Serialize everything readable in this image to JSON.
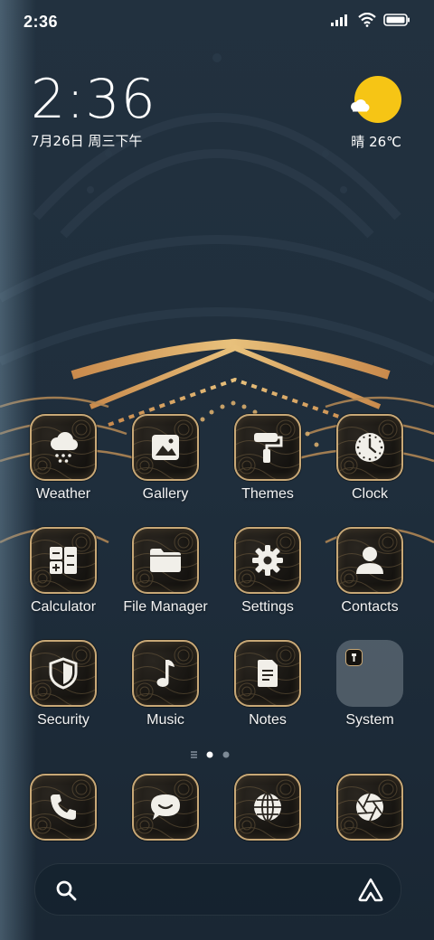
{
  "status_bar": {
    "time": "2:36",
    "icons": [
      "signal-icon",
      "wifi-icon",
      "battery-icon"
    ]
  },
  "clock_widget": {
    "time": "2:36",
    "date": "7月26日 周三下午"
  },
  "weather_widget": {
    "condition": "晴",
    "temperature": "晴 26℃",
    "icon": "sunny-cloud-icon"
  },
  "apps": [
    {
      "label": "Weather",
      "icon": "weather-icon"
    },
    {
      "label": "Gallery",
      "icon": "gallery-icon"
    },
    {
      "label": "Themes",
      "icon": "paint-roller-icon"
    },
    {
      "label": "Clock",
      "icon": "clock-icon"
    },
    {
      "label": "Calculator",
      "icon": "calculator-icon"
    },
    {
      "label": "File Manager",
      "icon": "folder-icon"
    },
    {
      "label": "Settings",
      "icon": "gear-icon"
    },
    {
      "label": "Contacts",
      "icon": "contact-icon"
    },
    {
      "label": "Security",
      "icon": "shield-icon"
    },
    {
      "label": "Music",
      "icon": "music-note-icon"
    },
    {
      "label": "Notes",
      "icon": "note-icon"
    },
    {
      "label": "System",
      "icon": "folder-group-icon"
    }
  ],
  "dock": [
    {
      "icon": "phone-icon"
    },
    {
      "icon": "message-icon"
    },
    {
      "icon": "globe-icon"
    },
    {
      "icon": "camera-aperture-icon"
    }
  ],
  "pager": {
    "current_page": 1,
    "total_pages": 2
  },
  "search_bar": {
    "icon": "search-icon",
    "assistant_icon": "assistant-icon"
  },
  "colors": {
    "icon_border": "#c8a876",
    "icon_bg": "#151310",
    "sun": "#f6c515",
    "wallpaper": "#1e2c3a"
  }
}
